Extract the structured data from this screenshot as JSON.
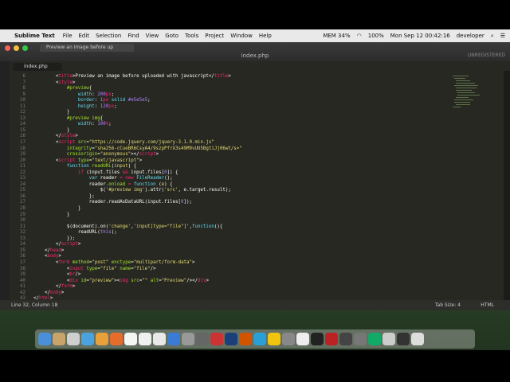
{
  "menubar": {
    "apple": "",
    "app": "Sublime Text",
    "items": [
      "File",
      "Edit",
      "Selection",
      "Find",
      "View",
      "Goto",
      "Tools",
      "Project",
      "Window",
      "Help"
    ],
    "status": {
      "cpu": "MEM 34%",
      "battery": "100%",
      "datetime": "Mon Sep 12  00:42:16",
      "user": "developer"
    }
  },
  "window": {
    "prev_tab": "Preview an image before up",
    "title": "index.php",
    "unregistered": "UNREGISTERED",
    "file_tab": "index.php"
  },
  "lines": [
    {
      "n": "6",
      "html": "<span class='w'>        &lt;</span><span class='t'>title</span><span class='w'>&gt;Preview an image before uploaded with javascript&lt;/</span><span class='t'>title</span><span class='w'>&gt;</span>"
    },
    {
      "n": "7",
      "html": "<span class='w'>        &lt;</span><span class='t'>style</span><span class='w'>&gt;</span>"
    },
    {
      "n": "8",
      "html": "<span class='a'>            #preview</span><span class='w'>{</span>"
    },
    {
      "n": "9",
      "html": "<span class='k'>                width</span><span class='w'>: </span><span class='n'>200</span><span class='t'>px</span><span class='w'>;</span>"
    },
    {
      "n": "10",
      "html": "<span class='k'>                border</span><span class='w'>: </span><span class='n'>1</span><span class='t'>px</span><span class='w'> </span><span class='k'>solid</span><span class='w'> </span><span class='n'>#e5e5e5</span><span class='w'>;</span>"
    },
    {
      "n": "11",
      "html": "<span class='k'>                height</span><span class='w'>: </span><span class='n'>120</span><span class='t'>px</span><span class='w'>;</span>"
    },
    {
      "n": "12",
      "html": "<span class='w'>            }</span>"
    },
    {
      "n": "13",
      "html": "<span class='a'>            #preview img</span><span class='w'>{</span>"
    },
    {
      "n": "14",
      "html": "<span class='k'>                width</span><span class='w'>: </span><span class='n'>100</span><span class='t'>%</span><span class='w'>;</span>"
    },
    {
      "n": "15",
      "html": "<span class='w'>            }</span>"
    },
    {
      "n": "16",
      "html": "<span class='w'>        &lt;/</span><span class='t'>style</span><span class='w'>&gt;</span>"
    },
    {
      "n": "17",
      "html": "<span class='w'>        &lt;</span><span class='t'>script</span><span class='w'> </span><span class='a'>src</span><span class='w'>=</span><span class='s'>\"https://code.jquery.com/jquery-3.1.0.min.js\"</span>"
    },
    {
      "n": "18",
      "html": "<span class='a'>            integrity</span><span class='w'>=</span><span class='s'>\"sha256-cCueBR6CsyA4/9szpPfrX3s49M9vUU5BgtiJj06wt/s=\"</span>"
    },
    {
      "n": "19",
      "html": "<span class='a'>            crossorigin</span><span class='w'>=</span><span class='s'>\"anonymous\"</span><span class='w'>&gt;&lt;/</span><span class='t'>script</span><span class='w'>&gt;</span>"
    },
    {
      "n": "20",
      "html": "<span class='w'>        &lt;</span><span class='t'>script</span><span class='w'> </span><span class='a'>type</span><span class='w'>=</span><span class='s'>\"text/javascript\"</span><span class='w'>&gt;</span>"
    },
    {
      "n": "21",
      "html": "<span class='k'>            function</span><span class='w'> </span><span class='a'>readURL</span><span class='w'>(</span><span class='s'>input</span><span class='w'>) {</span>"
    },
    {
      "n": "22",
      "html": "<span class='t'>                if</span><span class='w'> (input.files </span><span class='t'>&amp;&amp;</span><span class='w'> input.files[</span><span class='n'>0</span><span class='w'>]) {</span>"
    },
    {
      "n": "23",
      "html": "<span class='k'>                    var</span><span class='w'> reader </span><span class='t'>=</span><span class='w'> </span><span class='t'>new</span><span class='w'> </span><span class='k'>FileReader</span><span class='w'>();</span>"
    },
    {
      "n": "24",
      "html": "<span class='w'>                    reader.</span><span class='a'>onload</span><span class='w'> </span><span class='t'>=</span><span class='w'> </span><span class='k'>function</span><span class='w'> (</span><span class='s'>e</span><span class='w'>) {</span>"
    },
    {
      "n": "25",
      "html": "<span class='w'>                        $(</span><span class='s'>'#preview img'</span><span class='w'>).attr(</span><span class='s'>'src'</span><span class='w'>, e.target.result);</span>"
    },
    {
      "n": "26",
      "html": "<span class='w'>                    };</span>"
    },
    {
      "n": "27",
      "html": "<span class='w'>                    reader.readAsDataURL(input.files[</span><span class='n'>0</span><span class='w'>]);</span>"
    },
    {
      "n": "28",
      "html": "<span class='w'>                }</span>"
    },
    {
      "n": "29",
      "html": "<span class='w'>            }</span>"
    },
    {
      "n": "30",
      "html": ""
    },
    {
      "n": "31",
      "html": "<span class='w'>            $(document).on(</span><span class='s'>'change'</span><span class='w'>,</span><span class='s'>'input[type=\"file\"]'</span><span class='w'>,</span><span class='k'>function</span><span class='w'>(){</span>"
    },
    {
      "n": "32",
      "html": "<span class='w'>                readURL(</span><span class='n'>this</span><span class='w'>);</span>"
    },
    {
      "n": "33",
      "html": "<span class='w'>            });</span>"
    },
    {
      "n": "34",
      "html": "<span class='w'>        &lt;/</span><span class='t'>script</span><span class='w'>&gt;</span>"
    },
    {
      "n": "35",
      "html": "<span class='w'>    &lt;/</span><span class='t'>head</span><span class='w'>&gt;</span>"
    },
    {
      "n": "36",
      "html": "<span class='w'>    &lt;</span><span class='t'>body</span><span class='w'>&gt;</span>"
    },
    {
      "n": "37",
      "html": "<span class='w'>        &lt;</span><span class='t'>form</span><span class='w'> </span><span class='a'>method</span><span class='w'>=</span><span class='s'>\"post\"</span><span class='w'> </span><span class='a'>enctype</span><span class='w'>=</span><span class='s'>\"multipart/form-data\"</span><span class='w'>&gt;</span>"
    },
    {
      "n": "38",
      "html": "<span class='w'>            &lt;</span><span class='t'>input</span><span class='w'> </span><span class='a'>type</span><span class='w'>=</span><span class='s'>\"file\"</span><span class='w'> </span><span class='a'>name</span><span class='w'>=</span><span class='s'>\"file\"</span><span class='w'>/&gt;</span>"
    },
    {
      "n": "39",
      "html": "<span class='w'>            &lt;</span><span class='t'>br</span><span class='w'>/&gt;</span>"
    },
    {
      "n": "40",
      "html": "<span class='w'>            &lt;</span><span class='t'>div</span><span class='w'> </span><span class='a'>id</span><span class='w'>=</span><span class='s'>\"preview\"</span><span class='w'>&gt;&lt;</span><span class='t'>img</span><span class='w'> </span><span class='a'>src</span><span class='w'>=</span><span class='s'>\"\"</span><span class='w'> </span><span class='a'>alt</span><span class='w'>=</span><span class='s'>\"Preview\"</span><span class='w'>/&gt;&lt;/</span><span class='t'>div</span><span class='w'>&gt;</span>"
    },
    {
      "n": "41",
      "html": "<span class='w'>        &lt;/</span><span class='t'>form</span><span class='w'>&gt;</span>"
    },
    {
      "n": "42",
      "html": "<span class='w'>    &lt;/</span><span class='t'>body</span><span class='w'>&gt;</span>"
    },
    {
      "n": "43",
      "html": "<span class='w'>&lt;/</span><span class='t'>html</span><span class='w'>&gt;</span>"
    }
  ],
  "status": {
    "position": "Line 32, Column 18",
    "tab_size": "Tab Size: 4",
    "syntax": "HTML"
  },
  "dock": {
    "colors": [
      "#4a90d9",
      "#c8a36a",
      "#cfcfcf",
      "#4aa3df",
      "#e8a13a",
      "#e66c2c",
      "#f5f5f5",
      "#f0f0f0",
      "#e8e8e8",
      "#3a7bd5",
      "#999",
      "#666",
      "#c33",
      "#1c3f7a",
      "#d35400",
      "#2a9fd6",
      "#f1c40f",
      "#888",
      "#eee",
      "#222",
      "#b22",
      "#444",
      "#777",
      "#1a6",
      "#ccc",
      "#333",
      "#ddd"
    ]
  }
}
